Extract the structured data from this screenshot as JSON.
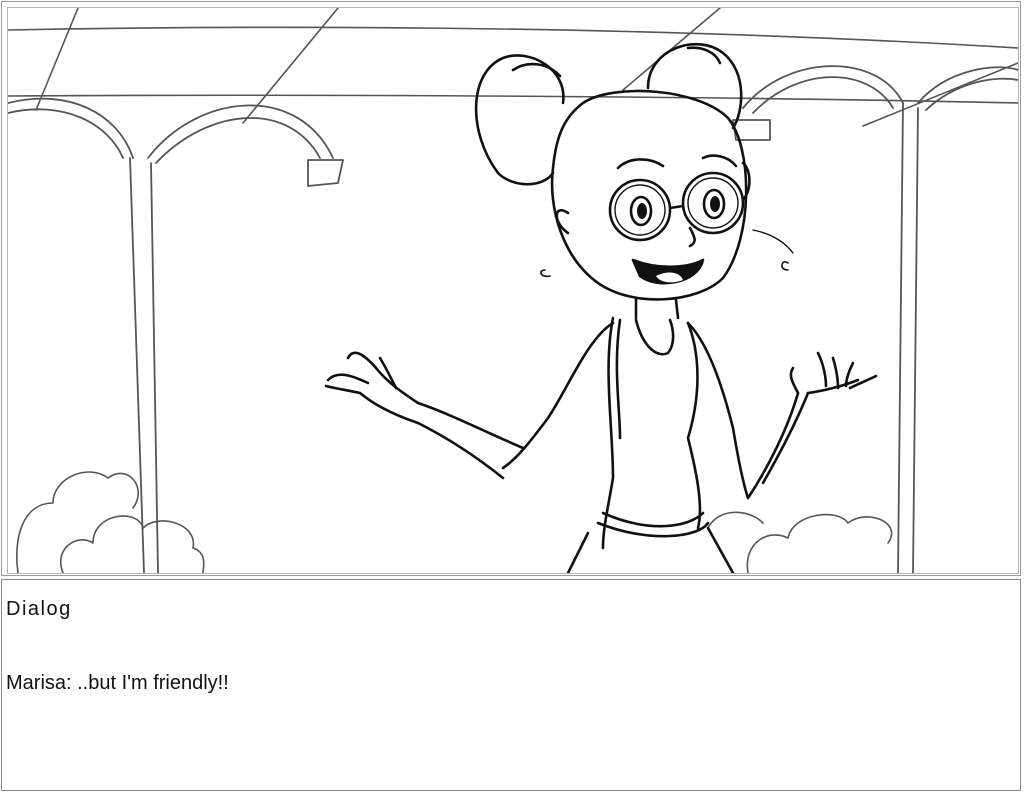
{
  "panel": {
    "art": {
      "icon": "storyboard-sketch-girl-with-glasses"
    }
  },
  "caption": {
    "heading": "Dialog",
    "line": "Marisa: ..but I'm friendly!!"
  }
}
